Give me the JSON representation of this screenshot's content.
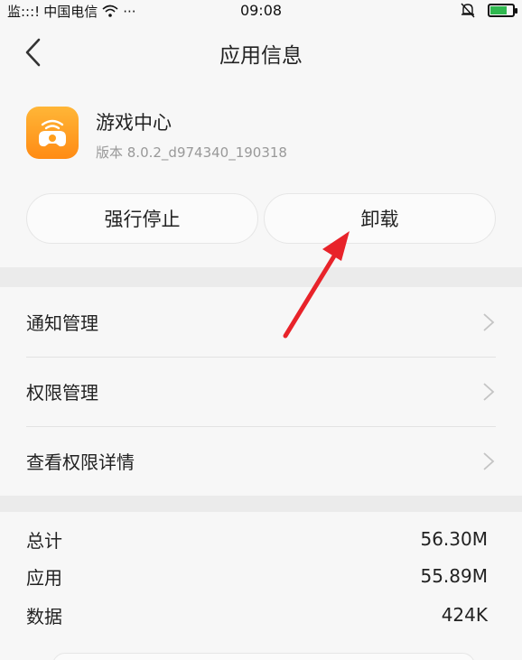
{
  "status_bar": {
    "signal_text": "监:::!",
    "carrier": "中国电信",
    "more": "···",
    "time": "09:08"
  },
  "header": {
    "title": "应用信息"
  },
  "app": {
    "name": "游戏中心",
    "version": "版本 8.0.2_d974340_190318",
    "icon": "gamepad-wifi-icon"
  },
  "actions": {
    "force_stop": "强行停止",
    "uninstall": "卸载"
  },
  "settings": {
    "items": [
      {
        "label": "通知管理"
      },
      {
        "label": "权限管理"
      },
      {
        "label": "查看权限详情"
      }
    ]
  },
  "storage": {
    "rows": [
      {
        "label": "总计",
        "value": "56.30M"
      },
      {
        "label": "应用",
        "value": "55.89M"
      },
      {
        "label": "数据",
        "value": "424K"
      }
    ]
  },
  "colors": {
    "accent_annotation": "#e8232a",
    "app_icon": "#ff9f1c",
    "battery": "#2fb84f"
  }
}
